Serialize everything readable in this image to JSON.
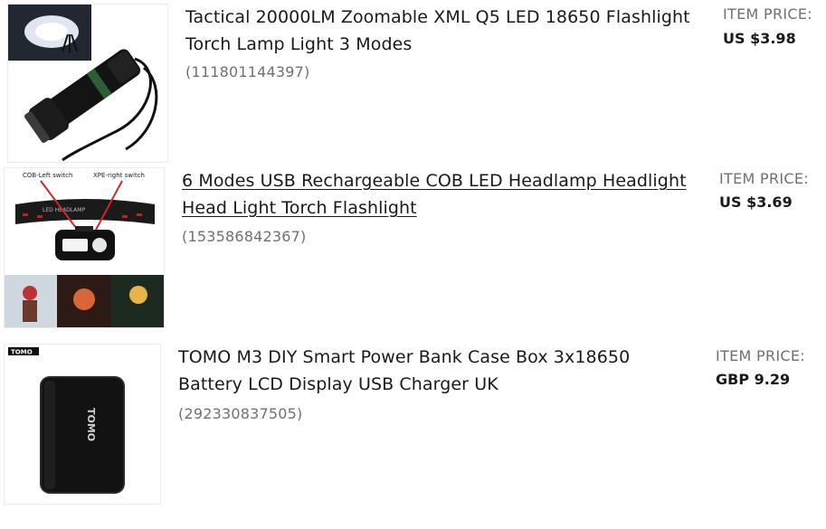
{
  "items": [
    {
      "title": "Tactical 20000LM Zoomable XML Q5 LED 18650 Flashlight Torch Lamp Light 3 Modes",
      "title_line1": "Tactical 20000LM Zoomable XML Q5 LED 18650 Flashlight",
      "title_line2": "Torch Lamp Light 3 Modes",
      "item_number": "(111801144397)",
      "price_label": "ITEM PRICE:",
      "price": "US $3.98",
      "image_icon": "flashlight-image"
    },
    {
      "title": "6 Modes USB Rechargeable COB LED Headlamp Headlight Head Light Torch Flashlight",
      "title_line1": "6 Modes USB Rechargeable COB LED Headlamp Headlight",
      "title_line2": "Head Light Torch Flashlight",
      "item_number": "(153586842367)",
      "price_label": "ITEM PRICE:",
      "price": "US $3.69",
      "image_icon": "headlamp-image",
      "image_text": {
        "left_switch": "COB-Left switch",
        "right_switch": "XPE-right switch",
        "band_text": "LED HEADLAMP"
      }
    },
    {
      "title": "TOMO M3 DIY Smart Power Bank Case Box 3x18650 Battery LCD Display USB Charger UK",
      "title_line1": "TOMO M3 DIY Smart Power Bank Case Box 3x18650",
      "title_line2": "Battery LCD Display USB Charger UK",
      "item_number": "(292330837505)",
      "price_label": "ITEM PRICE:",
      "price": "GBP 9.29",
      "image_icon": "power-bank-image",
      "image_text": {
        "logo": "TOMO",
        "device_text": "TOMO"
      }
    }
  ]
}
